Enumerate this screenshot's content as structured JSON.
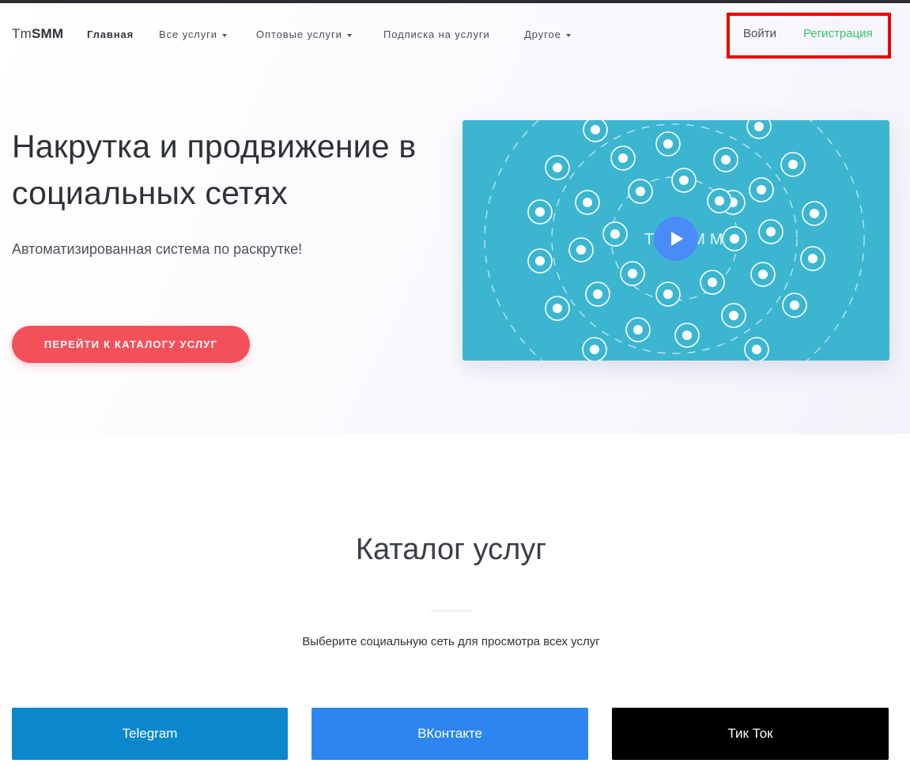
{
  "brand": {
    "prefix": "Tm",
    "bold": "SMM"
  },
  "nav": {
    "home": "Главная",
    "all_services": "Все услуги",
    "wholesale": "Оптовые услуги",
    "subscription": "Подписка на услуги",
    "other": "Другое"
  },
  "auth": {
    "login": "Войти",
    "register": "Регистрация"
  },
  "hero": {
    "title": "Накрутка и продвижение в социальных сетях",
    "subtitle": "Автоматизированная система по раскрутке!",
    "cta": "ПЕРЕЙТИ К КАТАЛОГУ УСЛУГ",
    "video_watermark": "TmSMM"
  },
  "catalog": {
    "title": "Каталог услуг",
    "subtitle": "Выберите социальную сеть для просмотра всех услуг",
    "tiles": [
      "Telegram",
      "ВКонтакте",
      "Тик Ток"
    ]
  },
  "colors": {
    "accent_cta": "#f4505a",
    "register": "#3ac46a",
    "video_bg": "#3cb6d0",
    "telegram": "#0b88cc",
    "vk": "#2d86f0",
    "tiktok": "#000000",
    "highlight_box": "#ee0000"
  },
  "video_icons": [
    "tiktok-icon",
    "heart-icon",
    "twitch-icon",
    "vk-icon",
    "flickr-icon",
    "snapchat-icon",
    "twitch-icon",
    "instagram-icon",
    "vk-icon",
    "vk-icon",
    "dropbox-icon",
    "vine-icon",
    "vine-icon",
    "twitter-icon",
    "viber-icon",
    "facebook-icon",
    "vine-icon",
    "twitch-icon",
    "skype-icon",
    "instagram-icon",
    "vine-icon",
    "share-icon",
    "vine-icon",
    "line-icon",
    "viber-icon",
    "twitch-icon",
    "facebook-icon",
    "linkedin-icon",
    "telegram-icon",
    "vine-icon",
    "location-icon",
    "line-icon",
    "vk-icon"
  ]
}
